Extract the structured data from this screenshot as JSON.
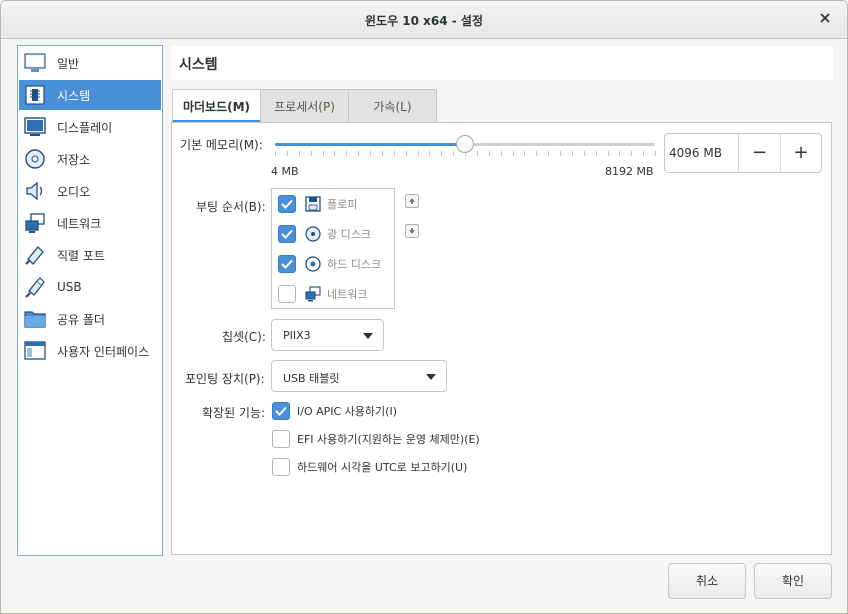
{
  "window": {
    "title": "윈도우 10 x64 - 설정"
  },
  "sidebar": {
    "items": [
      {
        "label": "일반",
        "icon": "general-icon"
      },
      {
        "label": "시스템",
        "icon": "system-chip-icon",
        "active": true
      },
      {
        "label": "디스플레이",
        "icon": "display-monitor-icon"
      },
      {
        "label": "저장소",
        "icon": "storage-disk-icon"
      },
      {
        "label": "오디오",
        "icon": "speaker-icon"
      },
      {
        "label": "네트워크",
        "icon": "network-icon"
      },
      {
        "label": "직렬 포트",
        "icon": "serial-port-icon"
      },
      {
        "label": "USB",
        "icon": "usb-icon"
      },
      {
        "label": "공유 폴더",
        "icon": "folder-icon"
      },
      {
        "label": "사용자 인터페이스",
        "icon": "user-interface-icon"
      }
    ]
  },
  "page": {
    "title": "시스템"
  },
  "tabs": [
    {
      "label": "마더보드(M)",
      "active": true
    },
    {
      "label": "프로세서(P)"
    },
    {
      "label": "가속(L)"
    }
  ],
  "motherboard": {
    "memory": {
      "label": "기본 메모리(M):",
      "min_label": "4 MB",
      "max_label": "8192 MB",
      "value_text": "4096 MB",
      "min": 4,
      "max": 8192,
      "value": 4096,
      "decrement": "−",
      "increment": "+"
    },
    "boot": {
      "label": "부팅 순서(B):",
      "items": [
        {
          "label": "플로피",
          "checked": true,
          "icon": "floppy-icon"
        },
        {
          "label": "광 디스크",
          "checked": true,
          "icon": "optical-disc-icon"
        },
        {
          "label": "하드 디스크",
          "checked": true,
          "icon": "hard-disk-icon"
        },
        {
          "label": "네트워크",
          "checked": false,
          "icon": "network-icon"
        }
      ]
    },
    "chipset": {
      "label": "칩셋(C):",
      "value": "PIIX3"
    },
    "pointing": {
      "label": "포인팅 장치(P):",
      "value": "USB 태블릿"
    },
    "features": {
      "label": "확장된 기능:",
      "items": [
        {
          "label": "I/O APIC 사용하기(I)",
          "checked": true
        },
        {
          "label": "EFI 사용하기(지원하는 운영 체제만)(E)",
          "checked": false
        },
        {
          "label": "하드웨어 시각을 UTC로 보고하기(U)",
          "checked": false
        }
      ]
    }
  },
  "buttons": {
    "cancel": "취소",
    "ok": "확인"
  },
  "colors": {
    "accent": "#4a90d9"
  }
}
